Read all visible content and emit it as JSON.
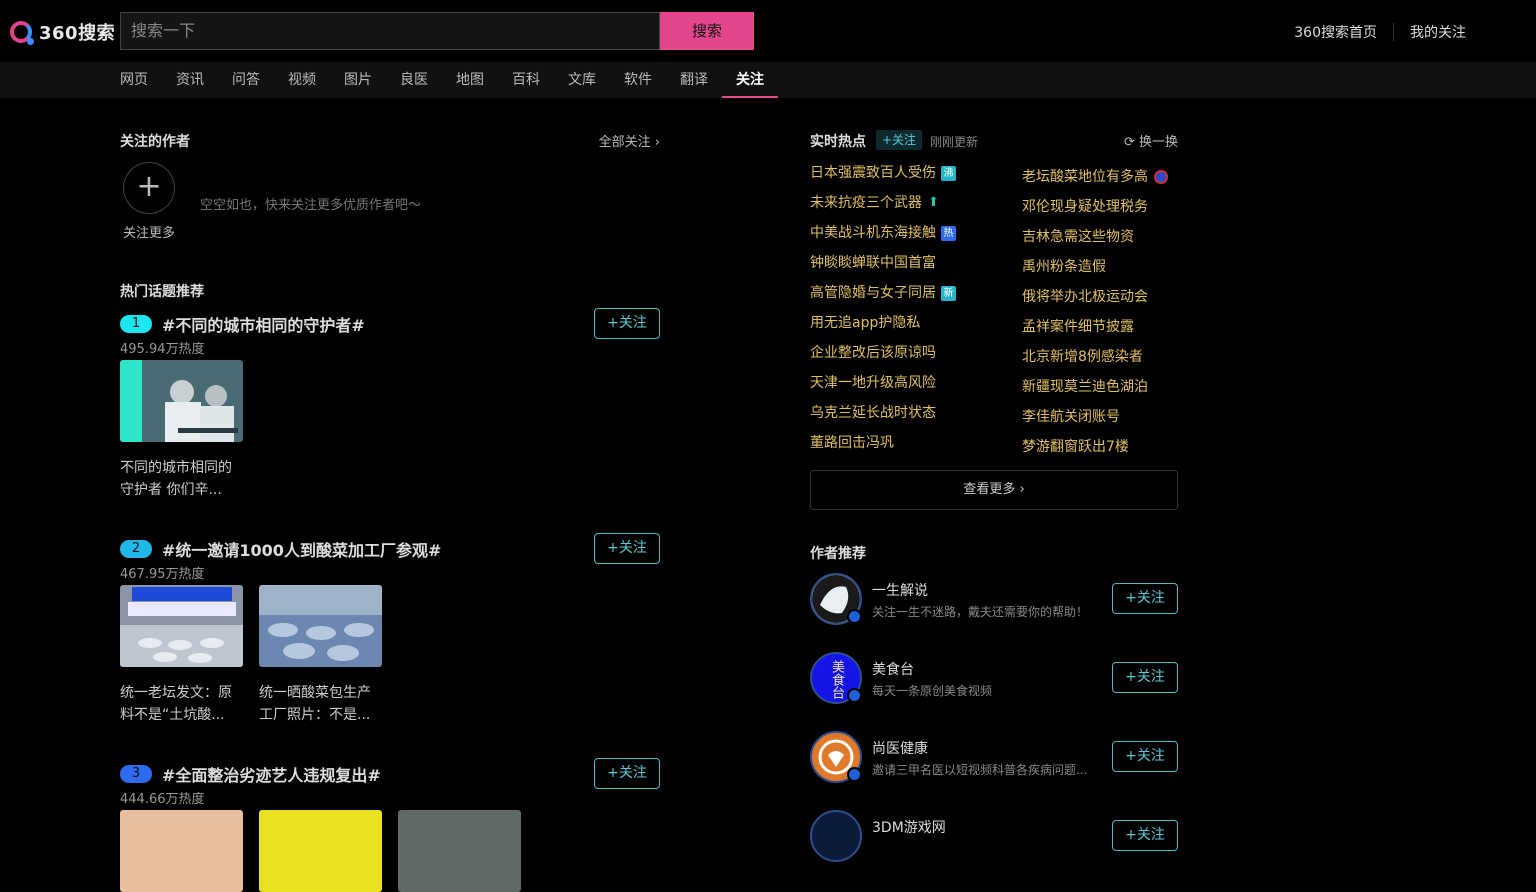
{
  "header": {
    "logo_text": "360搜索",
    "search_placeholder": "搜索一下",
    "search_button": "搜索",
    "links": [
      "360搜索首页",
      "我的关注"
    ]
  },
  "nav": {
    "tabs": [
      "网页",
      "资讯",
      "问答",
      "视频",
      "图片",
      "良医",
      "地图",
      "百科",
      "文库",
      "软件",
      "翻译",
      "关注"
    ],
    "active": "关注"
  },
  "followed": {
    "title": "关注的作者",
    "all_label": "全部关注",
    "add_label": "关注更多",
    "empty_tip": "空空如也，快来关注更多优质作者吧～"
  },
  "hot_topics": {
    "title": "热门话题推荐",
    "follow_label": "+关注",
    "items": [
      {
        "rank": "1",
        "name": "#不同的城市相同的守护者#",
        "heat": "495.94万热度",
        "rank_color": "#1ee6f0",
        "cards": [
          {
            "title_line1": "不同的城市相同的",
            "title_line2": "守护者 你们辛..."
          }
        ]
      },
      {
        "rank": "2",
        "name": "#统一邀请1000人到酸菜加工厂参观#",
        "heat": "467.95万热度",
        "rank_color": "#20b8e8",
        "cards": [
          {
            "title_line1": "统一老坛发文：原",
            "title_line2": "料不是“土坑酸..."
          },
          {
            "title_line1": "统一晒酸菜包生产",
            "title_line2": "工厂照片：不是..."
          }
        ]
      },
      {
        "rank": "3",
        "name": "#全面整治劣迹艺人违规复出#",
        "heat": "444.66万热度",
        "rank_color": "#2f6bf0",
        "cards": []
      }
    ]
  },
  "realtime": {
    "title": "实时热点",
    "follow_badge": "+关注",
    "updated": "刚刚更新",
    "refresh_label": "换一换",
    "left_items": [
      {
        "text": "日本强震致百人受伤",
        "tag": "沸"
      },
      {
        "text": "未来抗疫三个武器",
        "tag": ""
      },
      {
        "text": "中美战斗机东海接触",
        "tag": "热"
      },
      {
        "text": "钟睒睒蝉联中国首富",
        "tag": ""
      },
      {
        "text": "高管隐婚与女子同居",
        "tag": "新"
      },
      {
        "text": "用无追app护隐私",
        "tag": ""
      },
      {
        "text": "企业整改后该原谅吗",
        "tag": ""
      },
      {
        "text": "天津一地升级高风险",
        "tag": ""
      },
      {
        "text": "乌克兰延长战时状态",
        "tag": ""
      },
      {
        "text": "董路回击冯巩",
        "tag": ""
      }
    ],
    "right_items": [
      {
        "text": "老坛酸菜地位有多高"
      },
      {
        "text": "邓伦现身疑处理税务"
      },
      {
        "text": "吉林急需这些物资"
      },
      {
        "text": "禹州粉条造假"
      },
      {
        "text": "俄将举办北极运动会"
      },
      {
        "text": "孟祥案件细节披露"
      },
      {
        "text": "北京新增8例感染者"
      },
      {
        "text": "新疆现莫兰迪色湖泊"
      },
      {
        "text": "李佳航关闭账号"
      },
      {
        "text": "梦游翻窗跃出7楼"
      }
    ],
    "more_label": "查看更多"
  },
  "authors": {
    "title": "作者推荐",
    "follow_label": "+关注",
    "items": [
      {
        "name": "一生解说",
        "desc": "关注一生不迷路，戴夫还需要你的帮助！"
      },
      {
        "name": "美食台",
        "desc": "每天一条原创美食视频",
        "avatar_text": "美食台"
      },
      {
        "name": "尚医健康",
        "desc": "邀请三甲名医以短视频科普各疾病问题..."
      },
      {
        "name": "3DM游戏网",
        "desc": ""
      }
    ]
  },
  "colors": {
    "accent": "#e4468e",
    "follow": "#5bc8d6",
    "hot_text": "#e0c060"
  }
}
